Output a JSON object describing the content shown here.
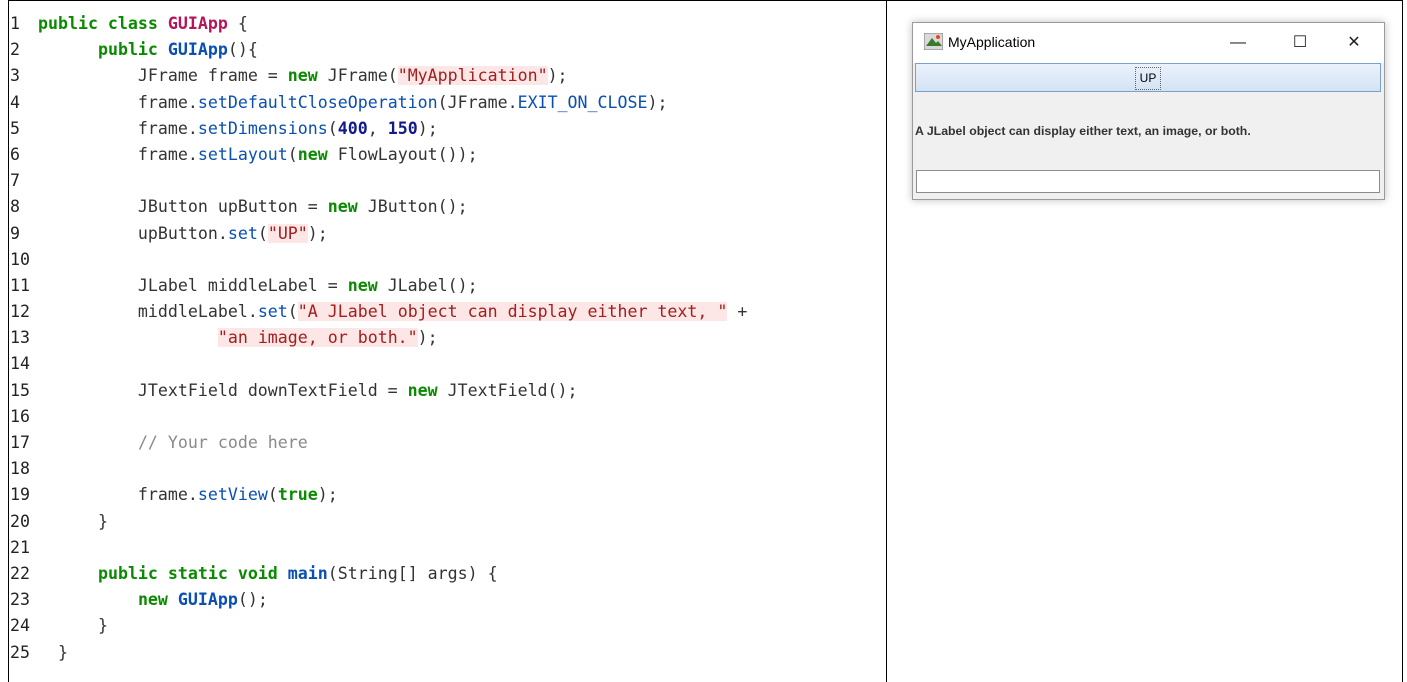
{
  "code_lines": [
    {
      "n": "1",
      "t": "public class GUIApp {"
    },
    {
      "n": "2",
      "t": "public GUIApp(){"
    },
    {
      "n": "3",
      "t": "JFrame frame = new JFrame(\"MyApplication\");"
    },
    {
      "n": "4",
      "t": "frame.setDefaultCloseOperation(JFrame.EXIT_ON_CLOSE);"
    },
    {
      "n": "5",
      "t": "frame.setDimensions(400, 150);"
    },
    {
      "n": "6",
      "t": "frame.setLayout(new FlowLayout());"
    },
    {
      "n": "7",
      "t": ""
    },
    {
      "n": "8",
      "t": "JButton upButton = new JButton();"
    },
    {
      "n": "9",
      "t": "upButton.set(\"UP\");"
    },
    {
      "n": "10",
      "t": ""
    },
    {
      "n": "11",
      "t": "JLabel middleLabel = new JLabel();"
    },
    {
      "n": "12",
      "t": "middleLabel.set(\"A JLabel object can display either text, \" +"
    },
    {
      "n": "13",
      "t": "\"an image, or both.\");"
    },
    {
      "n": "14",
      "t": ""
    },
    {
      "n": "15",
      "t": "JTextField downTextField = new JTextField();"
    },
    {
      "n": "16",
      "t": ""
    },
    {
      "n": "17",
      "t": "// Your code here"
    },
    {
      "n": "18",
      "t": ""
    },
    {
      "n": "19",
      "t": "frame.setView(true);"
    },
    {
      "n": "20",
      "t": "}"
    },
    {
      "n": "21",
      "t": ""
    },
    {
      "n": "22",
      "t": "public static void main(String[] args) {"
    },
    {
      "n": "23",
      "t": "new GUIApp();"
    },
    {
      "n": "24",
      "t": "}"
    },
    {
      "n": "25",
      "t": "}"
    }
  ],
  "window": {
    "title": "MyApplication",
    "minimize": "—",
    "maximize": "☐",
    "close": "✕",
    "button_label": "UP",
    "label_text": "A JLabel object can display either text, an image, or both.",
    "textfield_value": ""
  },
  "icons": {
    "app": "java-cup-icon"
  }
}
